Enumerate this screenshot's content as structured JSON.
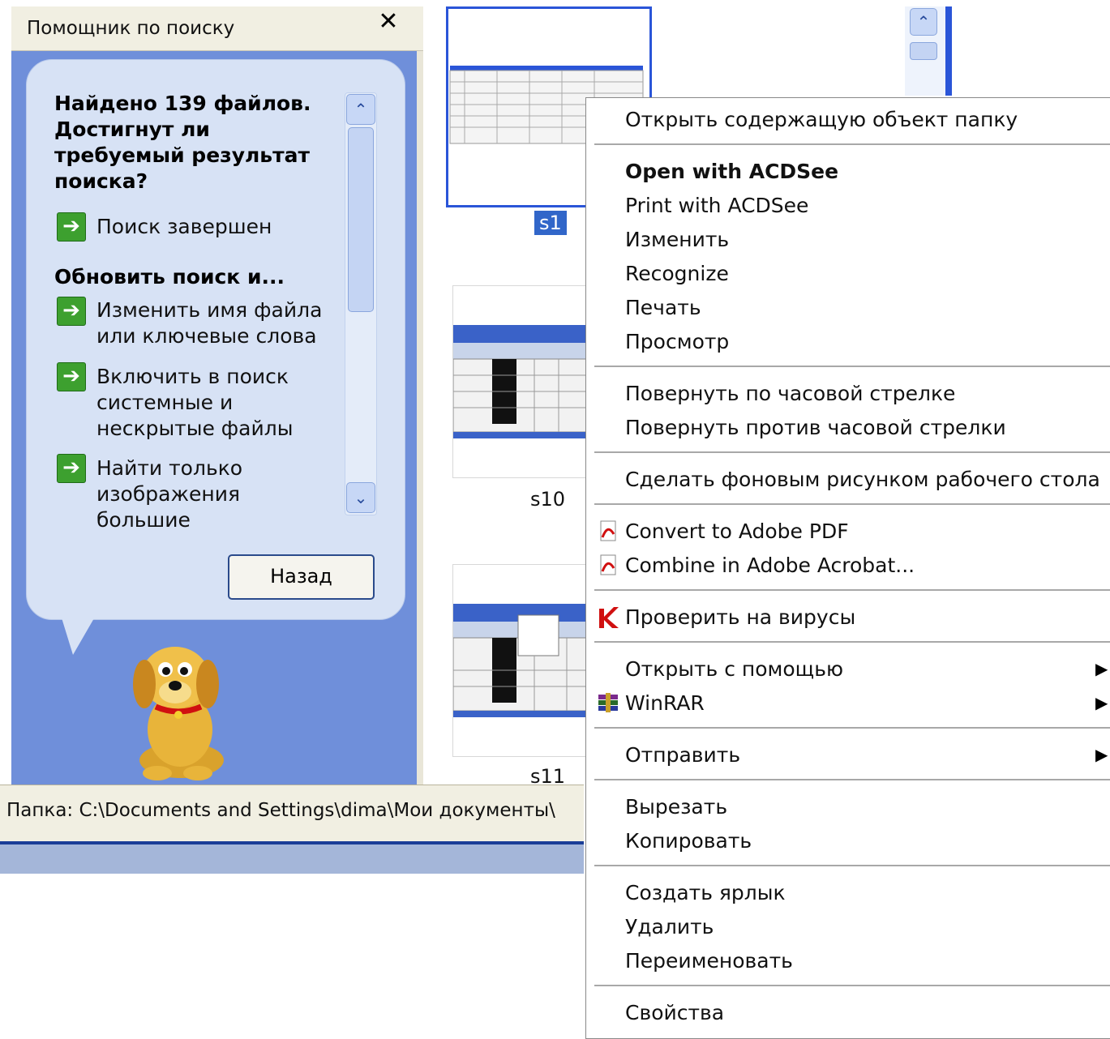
{
  "pane": {
    "title": "Помощник по поиску",
    "close": "✕",
    "question": "Найдено 139 файлов. Достигнут ли требуемый результат поиска?",
    "done": "Поиск завершен",
    "refine_heading": "Обновить поиск и...",
    "links": [
      "Изменить имя файла или ключевые слова",
      "Включить в поиск системные и нескрытые файлы",
      "Найти только изображения большие"
    ],
    "back_button": "Назад"
  },
  "statusbar": {
    "text": "Папка: C:\\Documents and Settings\\dima\\Мои документы\\"
  },
  "thumbnails": [
    {
      "label": "s1",
      "selected": true
    },
    {
      "label": "s10",
      "selected": false
    },
    {
      "label": "s11",
      "selected": false
    }
  ],
  "menu": {
    "items": [
      "Открыть содержащую объект папку",
      "Open with ACDSee",
      "Print with ACDSee",
      "Изменить",
      "Recognize",
      "Печать",
      "Просмотр",
      "Повернуть по часовой стрелке",
      "Повернуть против часовой стрелки",
      "Сделать фоновым рисунком рабочего стола",
      "Convert to Adobe PDF",
      "Combine in Adobe Acrobat...",
      "Проверить на вирусы",
      "Открыть с помощью",
      "WinRAR",
      "Отправить",
      "Вырезать",
      "Копировать",
      "Создать ярлык",
      "Удалить",
      "Переименовать",
      "Свойства"
    ]
  },
  "icons": {
    "arrow": "green-arrow-icon",
    "pdf": "adobe-pdf-icon",
    "antivirus": "kaspersky-icon",
    "winrar": "winrar-icon",
    "submenu": "submenu-arrow-icon"
  },
  "colors": {
    "pane_blue": "#6f8fda",
    "balloon": "#d7e2f5",
    "selection": "#3166c9",
    "arrow_green": "#3da02f"
  }
}
